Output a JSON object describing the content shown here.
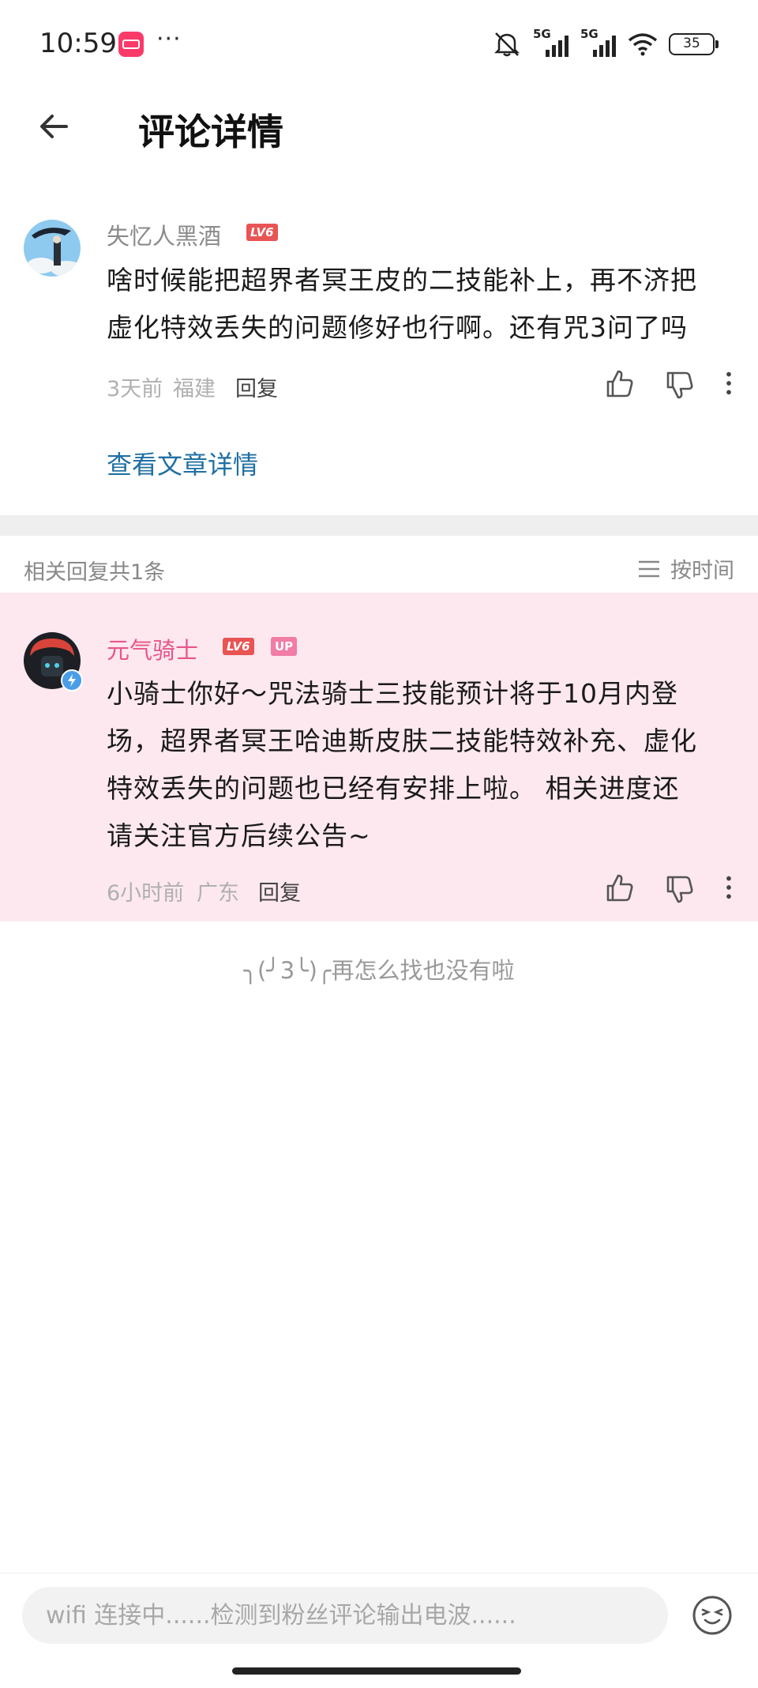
{
  "status_bar": {
    "time": "10:59",
    "more": "···",
    "battery": "35",
    "network_1": "5G",
    "network_2": "5G"
  },
  "header": {
    "title": "评论详情"
  },
  "comment": {
    "username": "失忆人黑酒",
    "level": "LV6",
    "text_line1": "啥时候能把超界者冥王皮的二技能补上，再不济把",
    "text_line2": "虚化特效丢失的问题修好也行啊。还有咒3问了吗",
    "time": "3天前",
    "location": "福建",
    "reply_label": "回复",
    "view_article": "查看文章详情"
  },
  "replies_section": {
    "count_label": "相关回复共1条",
    "sort_label": "按时间"
  },
  "reply": {
    "username": "元气骑士",
    "level": "LV6",
    "up_tag": "UP",
    "text_line1": "小骑士你好～咒法骑士三技能预计将于10月内登",
    "text_line2": "场，超界者冥王哈迪斯皮肤二技能特效补充、虚化",
    "text_line3": "特效丢失的问题也已经有安排上啦。 相关进度还",
    "text_line4": "请关注官方后续公告~",
    "time": "6小时前",
    "location": "广东",
    "reply_label": "回复",
    "name_color": "#e8558a"
  },
  "end_message": "╮(╯3╰)╭再怎么找也没有啦",
  "input": {
    "placeholder": "wifi 连接中......检测到粉丝评论输出电波......"
  },
  "icons": [
    "back-arrow-icon",
    "thumb-up-icon",
    "thumb-down-icon",
    "more-vertical-icon",
    "sort-list-icon",
    "emoji-icon",
    "verified-icon"
  ]
}
